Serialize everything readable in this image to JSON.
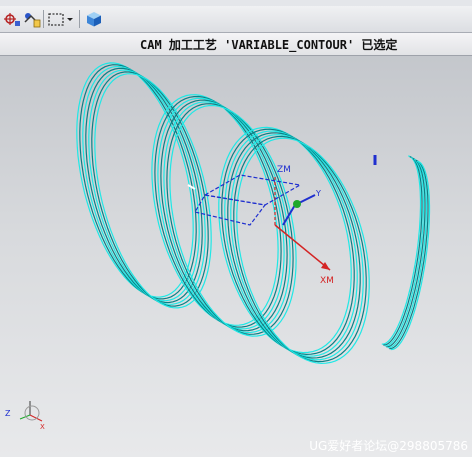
{
  "toolbar": {
    "tools": [
      {
        "name": "snap-point-tool-icon"
      },
      {
        "name": "select-tool-icon"
      },
      {
        "name": "selection-rectangle-icon"
      },
      {
        "name": "dropdown-arrow-icon"
      },
      {
        "name": "view-cube-icon"
      }
    ]
  },
  "status": {
    "message": "CAM 加工工艺 'VARIABLE_CONTOUR' 已选定"
  },
  "viewport": {
    "axes": {
      "xm_label": "XM",
      "zm_label": "ZM",
      "y_label": "Y",
      "x_label": "X",
      "z_label": "Z"
    },
    "colors": {
      "toolpath": "#1fe8e6",
      "toolpath_dark": "#0c7f85",
      "axis_red": "#d42424",
      "axis_blue": "#1f2fcf",
      "axis_green": "#1ea82a"
    }
  },
  "watermark": "UG爱好者论坛@298805786"
}
